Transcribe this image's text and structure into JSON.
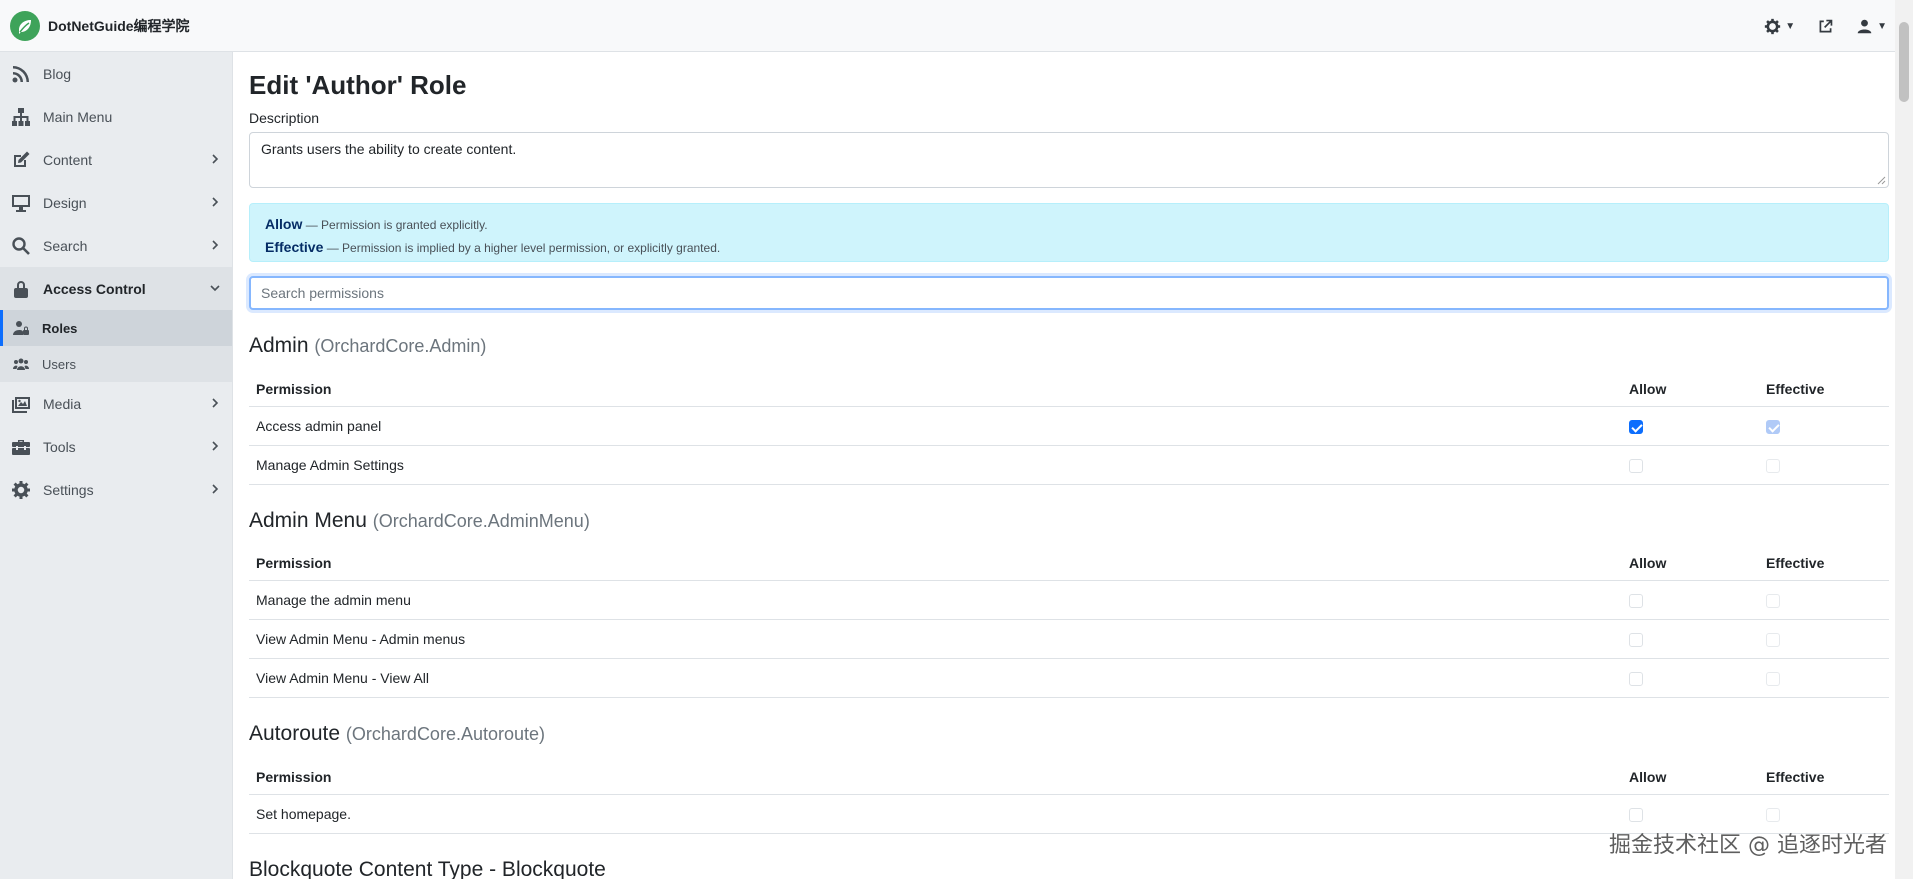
{
  "brand": {
    "name": "DotNetGuide编程学院"
  },
  "sidebar": {
    "items": [
      {
        "label": "Blog",
        "icon": "rss-icon",
        "chevron": false
      },
      {
        "label": "Main Menu",
        "icon": "sitemap-icon",
        "chevron": false
      },
      {
        "label": "Content",
        "icon": "edit-icon",
        "chevron": true
      },
      {
        "label": "Design",
        "icon": "desktop-icon",
        "chevron": true
      },
      {
        "label": "Search",
        "icon": "search-icon",
        "chevron": true
      },
      {
        "label": "Access Control",
        "icon": "lock-icon",
        "chevron": true,
        "expanded": true
      },
      {
        "label": "Media",
        "icon": "images-icon",
        "chevron": true
      },
      {
        "label": "Tools",
        "icon": "toolbox-icon",
        "chevron": true
      },
      {
        "label": "Settings",
        "icon": "cog-icon",
        "chevron": true
      }
    ],
    "sub_items": [
      {
        "label": "Roles",
        "icon": "user-lock-icon",
        "selected": true
      },
      {
        "label": "Users",
        "icon": "users-icon",
        "selected": false
      }
    ]
  },
  "main": {
    "title": "Edit 'Author' Role",
    "description_label": "Description",
    "description_value": "Grants users the ability to create content.",
    "alert": {
      "allow_term": "Allow",
      "allow_text": "— Permission is granted explicitly.",
      "effective_term": "Effective",
      "effective_text": "— Permission is implied by a higher level permission, or explicitly granted."
    },
    "search_placeholder": "Search permissions",
    "table_headers": {
      "permission": "Permission",
      "allow": "Allow",
      "effective": "Effective"
    },
    "groups": [
      {
        "name": "Admin",
        "module": "(OrchardCore.Admin)",
        "permissions": [
          {
            "name": "Access admin panel",
            "allow": true,
            "effective": true
          },
          {
            "name": "Manage Admin Settings",
            "allow": false,
            "effective": false
          }
        ]
      },
      {
        "name": "Admin Menu",
        "module": "(OrchardCore.AdminMenu)",
        "permissions": [
          {
            "name": "Manage the admin menu",
            "allow": false,
            "effective": false
          },
          {
            "name": "View Admin Menu - Admin menus",
            "allow": false,
            "effective": false
          },
          {
            "name": "View Admin Menu - View All",
            "allow": false,
            "effective": false
          }
        ]
      },
      {
        "name": "Autoroute",
        "module": "(OrchardCore.Autoroute)",
        "permissions": [
          {
            "name": "Set homepage.",
            "allow": false,
            "effective": false
          }
        ]
      },
      {
        "name": "Blockquote Content Type - Blockquote",
        "module": "",
        "permissions": []
      }
    ]
  },
  "watermark": "掘金技术社区 @ 追逐时光者",
  "colors": {
    "accent": "#0d6efd",
    "brand": "#3ea35a",
    "alert_bg": "#cff4fc"
  }
}
